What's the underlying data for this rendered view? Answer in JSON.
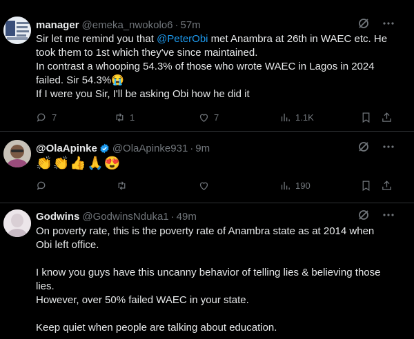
{
  "tweets": [
    {
      "name": "manager",
      "handle": "@emeka_nwokolo6",
      "time": "57m",
      "lines": [
        {
          "pre": "Sir let me remind you that ",
          "mention": "@PeterObi",
          "post": " met Anambra at 26th in WAEC etc. He"
        },
        {
          "pre": "took them to 1st which they've since maintained.",
          "mention": "",
          "post": ""
        },
        {
          "pre": "In contrast a whooping 54.3% of those who wrote WAEC in Lagos in 2024",
          "mention": "",
          "post": ""
        },
        {
          "pre": "failed. Sir 54.3%😭",
          "mention": "",
          "post": ""
        },
        {
          "pre": "If I were you Sir, I'll be asking Obi how he did it",
          "mention": "",
          "post": ""
        }
      ],
      "replies": "7",
      "reposts": "1",
      "likes": "7",
      "views": "1.1K"
    },
    {
      "name": "@OlaApinke",
      "handle": "@OlaApinke931",
      "time": "9m",
      "emoji": "👏👏👍🙏😍",
      "replies": "",
      "reposts": "",
      "likes": "",
      "views": "190"
    },
    {
      "name": "Godwins",
      "handle": "@GodwinsNduka1",
      "time": "49m",
      "lines": [
        "On poverty rate, this is the poverty rate of Anambra state as at 2014 when",
        "Obi left office.",
        "",
        "I know you guys have this uncanny behavior of telling lies & believing those",
        "lies.",
        "However, over 50% failed WAEC in your state.",
        "",
        "Keep quiet when people are talking about education."
      ]
    }
  ],
  "icons": {
    "grok": "grok-icon",
    "more": "more-icon",
    "reply": "reply-icon",
    "repost": "repost-icon",
    "like": "like-icon",
    "views": "views-icon",
    "bookmark": "bookmark-icon",
    "share": "share-icon"
  },
  "colors": {
    "background": "#000000",
    "text": "#e7e9ea",
    "muted": "#71767b",
    "link": "#1d9bf0",
    "verified": "#1d9bf0"
  }
}
